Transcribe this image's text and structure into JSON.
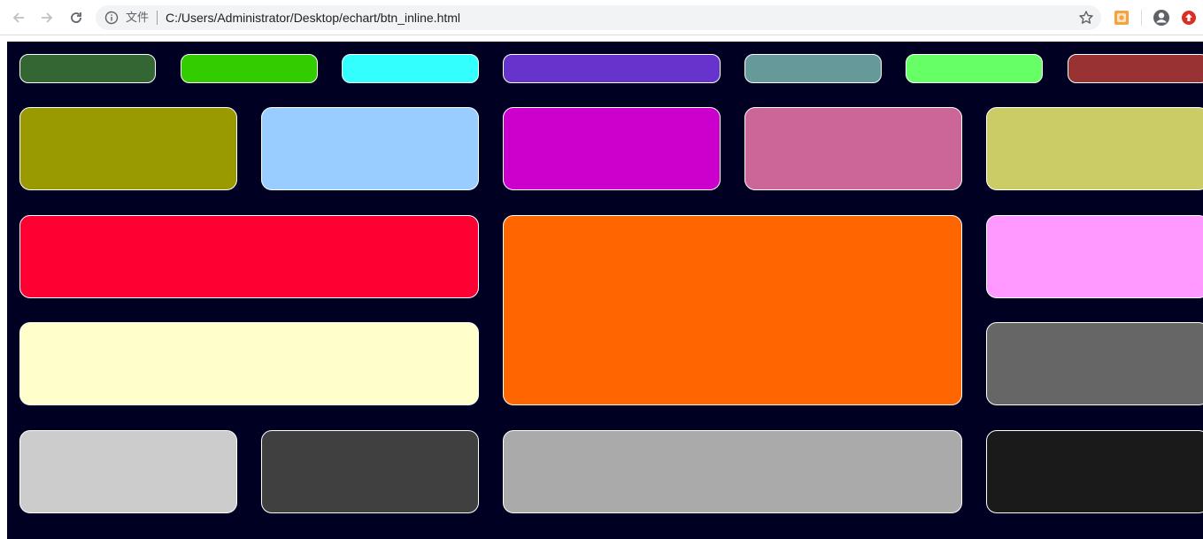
{
  "browser": {
    "scheme_label": "文件",
    "url": "C:/Users/Administrator/Desktop/echart/btn_inline.html",
    "icons": [
      "back-icon",
      "forward-icon",
      "reload-icon",
      "info-icon",
      "star-icon",
      "extension-icon",
      "profile-icon",
      "update-icon"
    ]
  },
  "page": {
    "background": "#000022",
    "tiles": [
      {
        "id": "t1",
        "color": "#336633"
      },
      {
        "id": "t2",
        "color": "#33cc00"
      },
      {
        "id": "t3",
        "color": "#33ffff"
      },
      {
        "id": "t4",
        "color": "#6633cc"
      },
      {
        "id": "t5",
        "color": "#669999"
      },
      {
        "id": "t6",
        "color": "#66ff66"
      },
      {
        "id": "t7",
        "color": "#993333"
      },
      {
        "id": "t8",
        "color": "#999900"
      },
      {
        "id": "t9",
        "color": "#99ccff"
      },
      {
        "id": "t10",
        "color": "#cc00cc"
      },
      {
        "id": "t11",
        "color": "#cc6699"
      },
      {
        "id": "t12",
        "color": "#cccc66"
      },
      {
        "id": "t13",
        "color": "#ff0033"
      },
      {
        "id": "t14",
        "color": "#ff6600"
      },
      {
        "id": "t15",
        "color": "#ff99ff"
      },
      {
        "id": "t16",
        "color": "#ffffcc"
      },
      {
        "id": "t17",
        "color": "#666666"
      },
      {
        "id": "t18",
        "color": "#cccccc"
      },
      {
        "id": "t19",
        "color": "#404040"
      },
      {
        "id": "t20",
        "color": "#aaaaaa"
      },
      {
        "id": "t21",
        "color": "#1a1a1a"
      }
    ]
  }
}
